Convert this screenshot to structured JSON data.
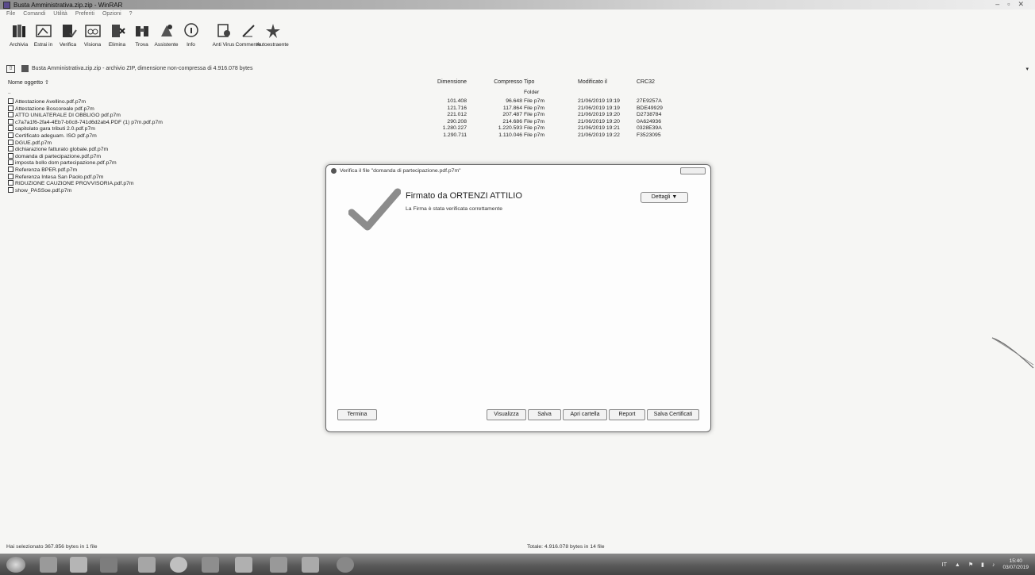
{
  "window": {
    "title": "Busta Amministrativa.zip.zip - WinRAR",
    "controls": [
      "–",
      "▫",
      "✕"
    ]
  },
  "menu": [
    "File",
    "Comandi",
    "Utilità",
    "Preferiti",
    "Opzioni",
    "?"
  ],
  "toolbar": [
    {
      "label": "Archivia",
      "icon": "archive-books-icon"
    },
    {
      "label": "Estrai in",
      "icon": "extract-folder-icon"
    },
    {
      "label": "Verifica",
      "icon": "test-book-icon"
    },
    {
      "label": "Visiona",
      "icon": "view-glasses-icon"
    },
    {
      "label": "Elimina",
      "icon": "delete-bin-icon"
    },
    {
      "label": "Trova",
      "icon": "find-binoculars-icon"
    },
    {
      "label": "Assistente",
      "icon": "wizard-icon"
    },
    {
      "label": "Info",
      "icon": "info-icon"
    },
    {
      "label": "Anti Virus",
      "icon": "antivirus-icon"
    },
    {
      "label": "Commento",
      "icon": "comment-pen-icon"
    },
    {
      "label": "Autoestraente",
      "icon": "sfx-icon"
    }
  ],
  "pathbar": {
    "up_label": "⇧",
    "path": "Busta Amministrativa.zip.zip - archivio ZIP, dimensione non-compressa di 4.916.078 bytes",
    "dropdown": "▾"
  },
  "columns": {
    "name": "Nome oggetto",
    "name_sort": "⇧",
    "size": "Dimensione",
    "packed": "Compresso",
    "type": "Tipo",
    "modified": "Modificato il",
    "crc": "CRC32"
  },
  "parent_row": {
    "name": "..",
    "type": "Folder"
  },
  "files": [
    {
      "name": "Attestazione Avellino.pdf.p7m",
      "size": "101.408",
      "packed": "96.648",
      "type": "File p7m",
      "modified": "21/06/2019 19:19",
      "crc": "27E9257A"
    },
    {
      "name": "Attestazione Boscoreale pdf.p7m",
      "size": "121.716",
      "packed": "117.864",
      "type": "File p7m",
      "modified": "21/06/2019 19:19",
      "crc": "BDE49929"
    },
    {
      "name": "ATTO UNILATERALE DI OBBLIGO pdf.p7m",
      "size": "221.012",
      "packed": "207.487",
      "type": "File p7m",
      "modified": "21/06/2019 19:20",
      "crc": "D2738784"
    },
    {
      "name": "c7a7a1f6-2fa4-4Eb7-b0c8-741d6d2ab4.PDF (1) p7m.pdf.p7m",
      "size": "290.208",
      "packed": "214.686",
      "type": "File p7m",
      "modified": "21/06/2019 19:20",
      "crc": "0A624936"
    },
    {
      "name": "capitolato gara tributi 2.0.pdf.p7m",
      "size": "1.280.227",
      "packed": "1.220.593",
      "type": "File p7m",
      "modified": "21/06/2019 19:21",
      "crc": "0328E39A"
    },
    {
      "name": "Certificato adeguam. ISO pdf.p7m",
      "size": "1.290.711",
      "packed": "1.110.046",
      "type": "File p7m",
      "modified": "21/06/2019 19:22",
      "crc": "F3523095"
    },
    {
      "name": "DGUE.pdf.p7m",
      "size": "",
      "packed": "",
      "type": "",
      "modified": "",
      "crc": ""
    },
    {
      "name": "dichiarazione fatturato globale.pdf.p7m",
      "size": "",
      "packed": "",
      "type": "",
      "modified": "",
      "crc": ""
    },
    {
      "name": "domanda di partecipazione.pdf.p7m",
      "size": "",
      "packed": "",
      "type": "",
      "modified": "",
      "crc": ""
    },
    {
      "name": "imposta bollo dom partecipazione.pdf.p7m",
      "size": "",
      "packed": "",
      "type": "",
      "modified": "",
      "crc": ""
    },
    {
      "name": "Referenza BPER.pdf.p7m",
      "size": "",
      "packed": "",
      "type": "",
      "modified": "",
      "crc": ""
    },
    {
      "name": "Referenza Intesa San Paolo.pdf.p7m",
      "size": "",
      "packed": "",
      "type": "",
      "modified": "",
      "crc": ""
    },
    {
      "name": "RIDUZIONE CAUZIONE PROVVISORIA.pdf.p7m",
      "size": "",
      "packed": "",
      "type": "",
      "modified": "",
      "crc": ""
    },
    {
      "name": "show_PASSoe.pdf.p7m",
      "size": "",
      "packed": "",
      "type": "",
      "modified": "",
      "crc": ""
    }
  ],
  "dialog": {
    "title": "Verifica il file \"domanda di partecipazione.pdf.p7m\"",
    "signer": "Firmato da ORTENZI ATTILIO",
    "status": "La Firma è stata verificata correttamente",
    "details_button": "Dettagli ▼",
    "buttons": {
      "close": "Termina",
      "view": "Visualizza",
      "save": "Salva",
      "open_folder": "Apri cartella",
      "report": "Report",
      "save_certs": "Salva Certificati"
    },
    "check_color": "#8c8c8c"
  },
  "status": {
    "left": "Hai selezionato 367.856 bytes in 1 file",
    "right": "Totale: 4.916.078 bytes in 14 file"
  },
  "taskbar": {
    "items": [
      "start-orb-icon",
      "internet-explorer-icon",
      "file-explorer-icon",
      "media-player-icon",
      "documents-icon",
      "chrome-icon",
      "winrar-icon",
      "remote-desktop-icon",
      "notes-icon",
      "app-icon",
      "settings-icon"
    ],
    "tray_lang": "IT",
    "time": "15:40",
    "date": "03/07/2019"
  }
}
